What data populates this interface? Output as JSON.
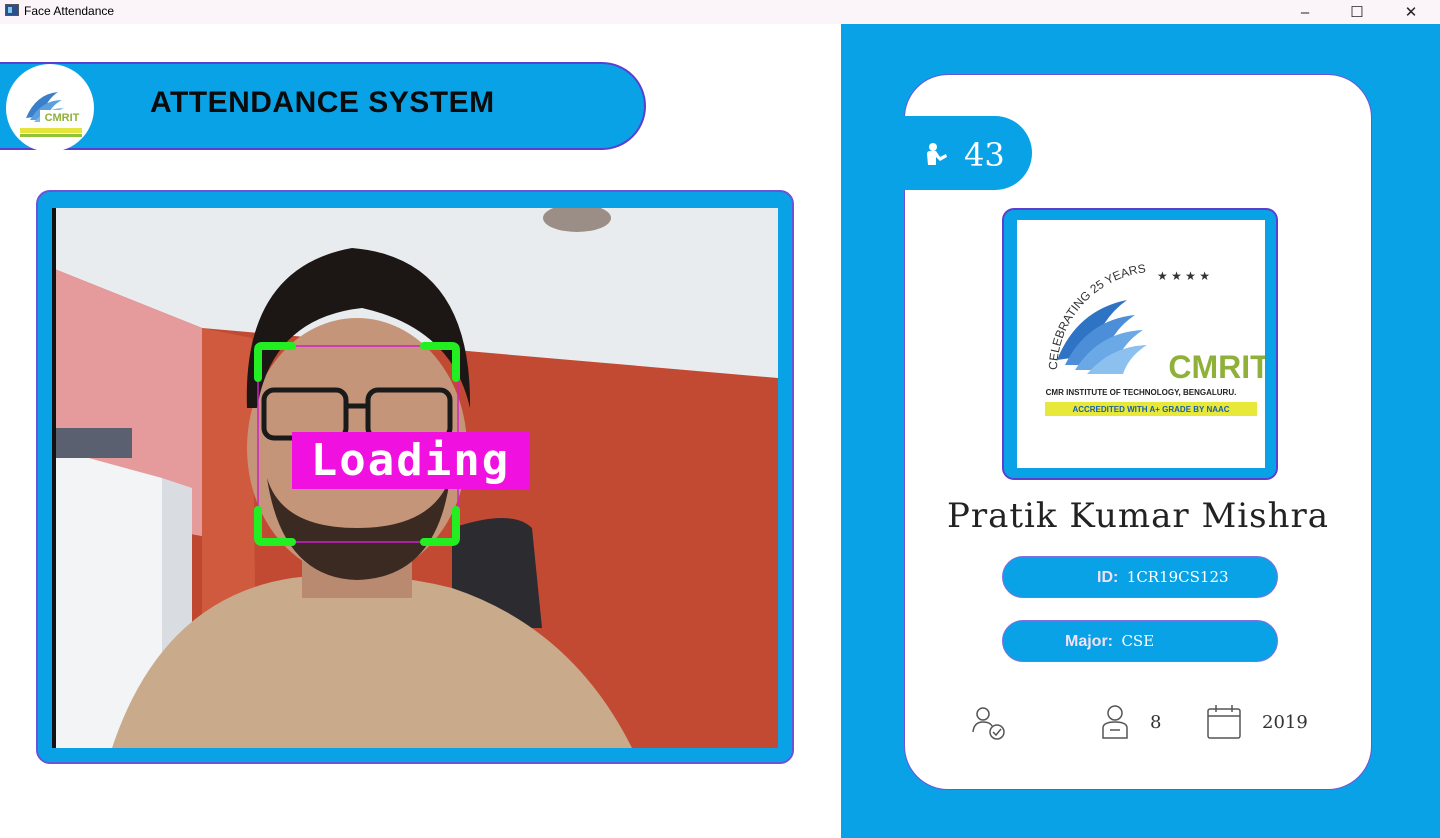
{
  "window": {
    "title": "Face Attendance",
    "controls": {
      "minimize": "–",
      "maximize": "☐",
      "close": "✕"
    }
  },
  "header": {
    "title": "ATTENDANCE SYSTEM",
    "logo_text": "CMRIT"
  },
  "camera": {
    "overlay_label": "Loading",
    "accent_color": "#0aa2e6",
    "box_color": "#22ee22",
    "label_bg": "#f010e0"
  },
  "student": {
    "total_attendance": "43",
    "name": "Pratik Kumar Mishra",
    "id_label": "ID:",
    "id_value": "1CR19CS123",
    "major_label": "Major:",
    "major_value": "CSE",
    "standing_icon": "user-check-icon",
    "year_value": "8",
    "starting_year": "2019"
  },
  "logo": {
    "arc_text": "CELEBRATING 25 YEARS",
    "brand": "CMRIT",
    "institute": "CMR INSTITUTE OF TECHNOLOGY, BENGALURU.",
    "accreditation": "ACCREDITED WITH A+ GRADE BY NAAC"
  }
}
